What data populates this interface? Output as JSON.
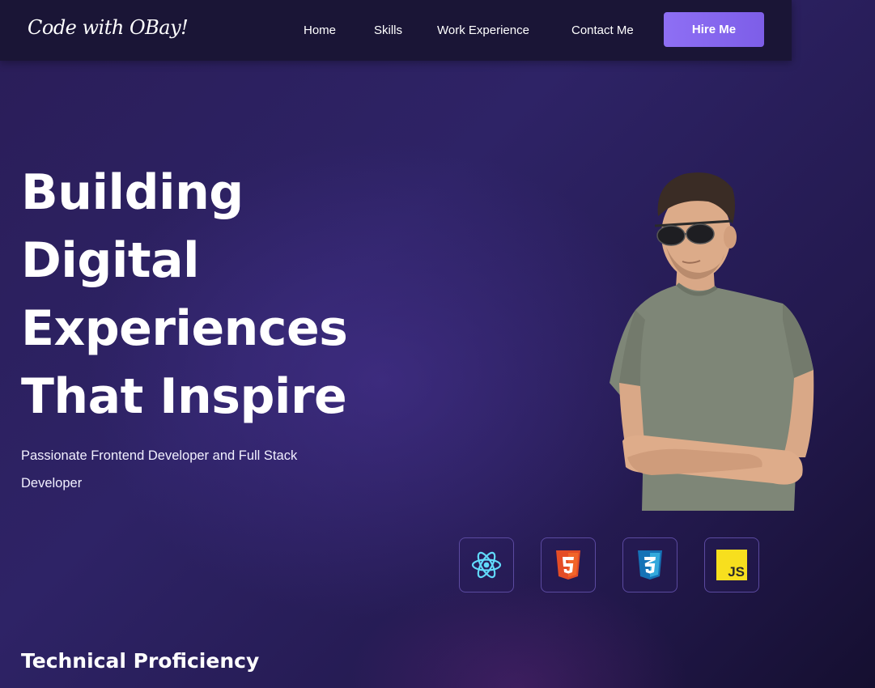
{
  "brand": {
    "logo_text": "Code with OBay!"
  },
  "nav": {
    "links": [
      "Home",
      "Skills",
      "Work Experience",
      "Contact Me"
    ],
    "cta_label": "Hire Me",
    "cta_color": "#8e6ff4"
  },
  "hero": {
    "title_lines": [
      "Building",
      "Digital",
      "Experiences",
      "That Inspire"
    ],
    "subtitle": "Passionate Frontend Developer and Full Stack Developer",
    "portrait": "photo of a young man with sunglasses in a grey t-shirt, arms crossed"
  },
  "tech_icons": [
    {
      "name": "react-icon",
      "color": "#61dafb"
    },
    {
      "name": "html5-icon",
      "color": "#e44d26"
    },
    {
      "name": "css3-icon",
      "color": "#1572b6"
    },
    {
      "name": "javascript-icon",
      "color": "#f7df1e",
      "text": "JS"
    }
  ],
  "sections": {
    "technical_title": "Technical Proficiency"
  },
  "colors": {
    "background_dark": "#150f30",
    "background_mid": "#2e2366",
    "navbar": "#1a1536",
    "accent": "#8e6ff4"
  }
}
